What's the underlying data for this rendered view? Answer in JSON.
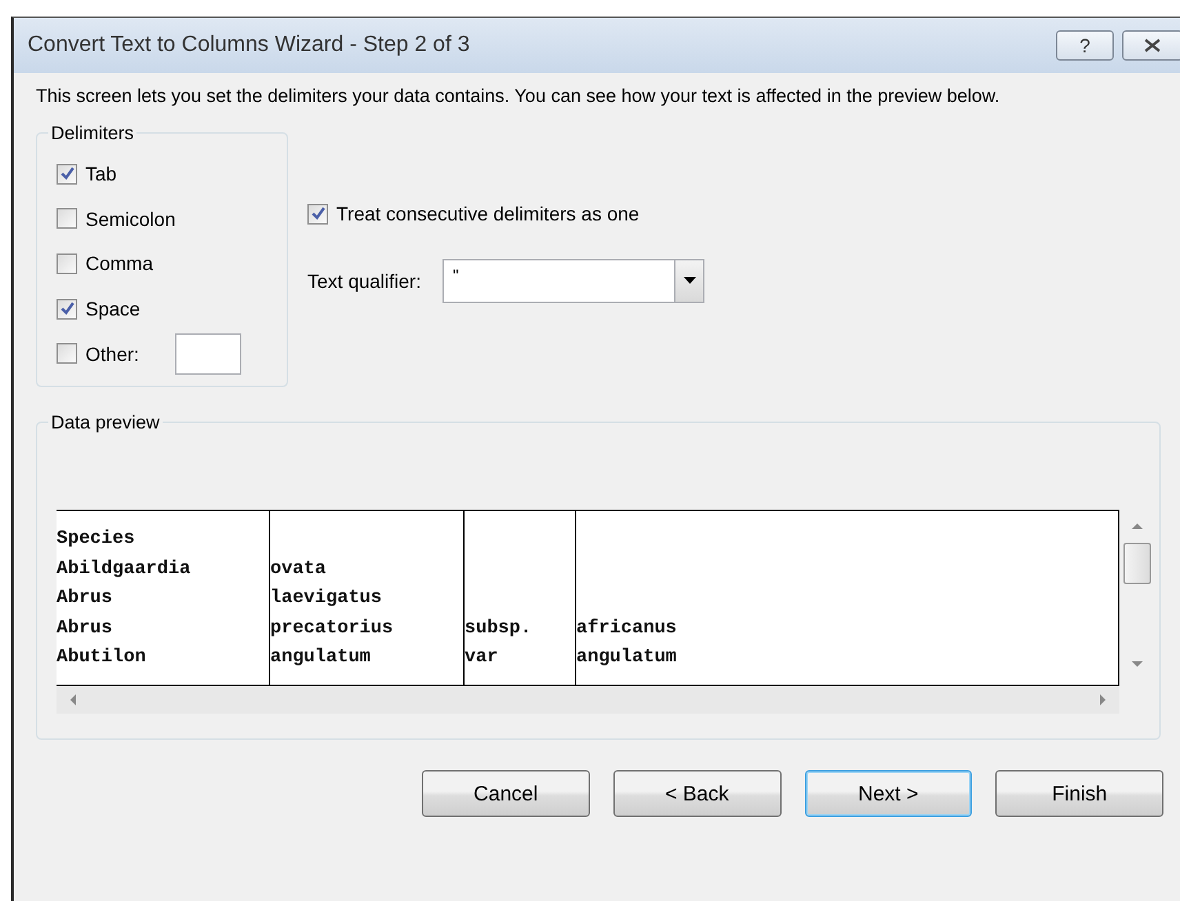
{
  "window": {
    "title": "Convert Text to Columns Wizard - Step 2 of 3",
    "help_button": "?"
  },
  "instructions": "This screen lets you set the delimiters your data contains.  You can see how your text is affected in the preview below.",
  "delimiters": {
    "legend": "Delimiters",
    "items": [
      {
        "label": "Tab",
        "checked": true
      },
      {
        "label": "Semicolon",
        "checked": false
      },
      {
        "label": "Comma",
        "checked": false
      },
      {
        "label": "Space",
        "checked": true
      },
      {
        "label": "Other:",
        "checked": false,
        "kind": "with-field"
      }
    ]
  },
  "consecutive": {
    "label": "Treat consecutive delimiters as one",
    "checked": true
  },
  "text_qualifier": {
    "label": "Text qualifier:",
    "value": "\""
  },
  "data_preview": {
    "legend": "Data preview",
    "rows": [
      [
        "Species"
      ],
      [
        "Abildgaardia",
        "ovata"
      ],
      [
        "Abrus",
        "laevigatus"
      ],
      [
        "Abrus",
        "precatorius",
        "subsp.",
        "africanus"
      ],
      [
        "Abutilon",
        "angulatum",
        "var",
        "angulatum"
      ]
    ]
  },
  "buttons": [
    {
      "label": "Cancel",
      "default": false
    },
    {
      "label": "< Back",
      "default": false
    },
    {
      "label": "Next >",
      "default": true
    },
    {
      "label": "Finish",
      "default": false
    }
  ]
}
